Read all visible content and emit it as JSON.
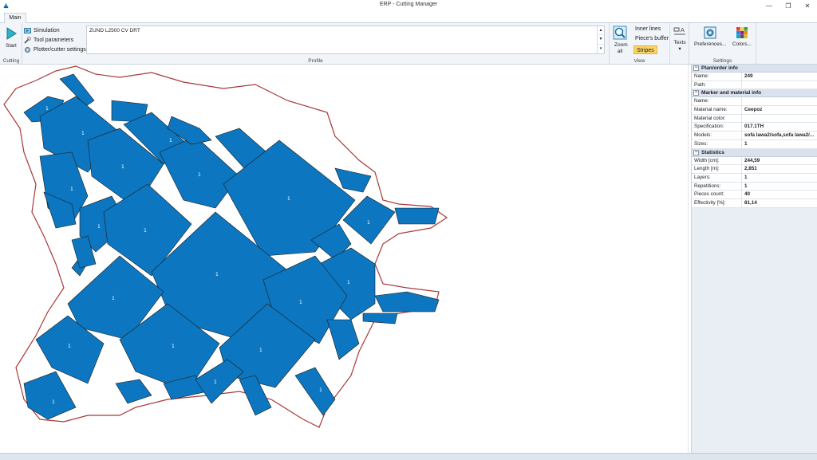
{
  "window": {
    "title": "ERP - Cutting Manager",
    "minimize": "—",
    "restore": "❐",
    "close": "✕"
  },
  "tabs": [
    {
      "label": "Main"
    }
  ],
  "ribbon": {
    "cutting": {
      "start_label": "Start",
      "simulation_label": "Simulation",
      "tool_parameters_label": "Tool parameters",
      "plotter_label": "Plotter/cutter settings",
      "group_label": "Cutting"
    },
    "profile": {
      "value": "ZUND L2500 CV DRT",
      "group_label": "Profile"
    },
    "view": {
      "zoom_all_label": "Zoom all",
      "inner_lines_label": "Inner lines",
      "pieces_buffer_label": "Piece's buffer",
      "stripes_label": "Stripes",
      "group_label": "View"
    },
    "texts": {
      "label": "Texts"
    },
    "settings": {
      "preferences_label": "Preferences...",
      "colors_label": "Colors...",
      "group_label": "Settings"
    }
  },
  "panel": {
    "plan_info": {
      "header": "Plan/order info",
      "rows": [
        {
          "key": "Name:",
          "value": "249"
        },
        {
          "key": "Path:",
          "value": ""
        }
      ]
    },
    "marker_info": {
      "header": "Marker and material info",
      "rows": [
        {
          "key": "Name:",
          "value": ""
        },
        {
          "key": "Material name:",
          "value": "Ceepoz"
        },
        {
          "key": "Material color:",
          "value": ""
        },
        {
          "key": "Specification:",
          "value": "017.1TH"
        },
        {
          "key": "Models:",
          "value": "sofa lawa2/sofa,sofa lawa2/..."
        },
        {
          "key": "Sizes:",
          "value": "1"
        }
      ]
    },
    "statistics": {
      "header": "Statistics",
      "rows": [
        {
          "key": "Width [cm]:",
          "value": "244,59"
        },
        {
          "key": "Length [m]:",
          "value": "2,851"
        },
        {
          "key": "Layers:",
          "value": "1"
        },
        {
          "key": "Repetitions:",
          "value": "1"
        },
        {
          "key": "Pieces count:",
          "value": "40"
        },
        {
          "key": "Effectivity [%]:",
          "value": "81,14"
        }
      ]
    }
  },
  "canvas": {
    "piece_label": "1",
    "piece_color": "#0c77c0",
    "outline_color": "#a8383a"
  },
  "colors": {
    "ribbon_bg": "#f1f5fa",
    "panel_bg": "#e9eef5",
    "header_bg": "#d9e2ee",
    "stripes_active": "#fbd566"
  }
}
